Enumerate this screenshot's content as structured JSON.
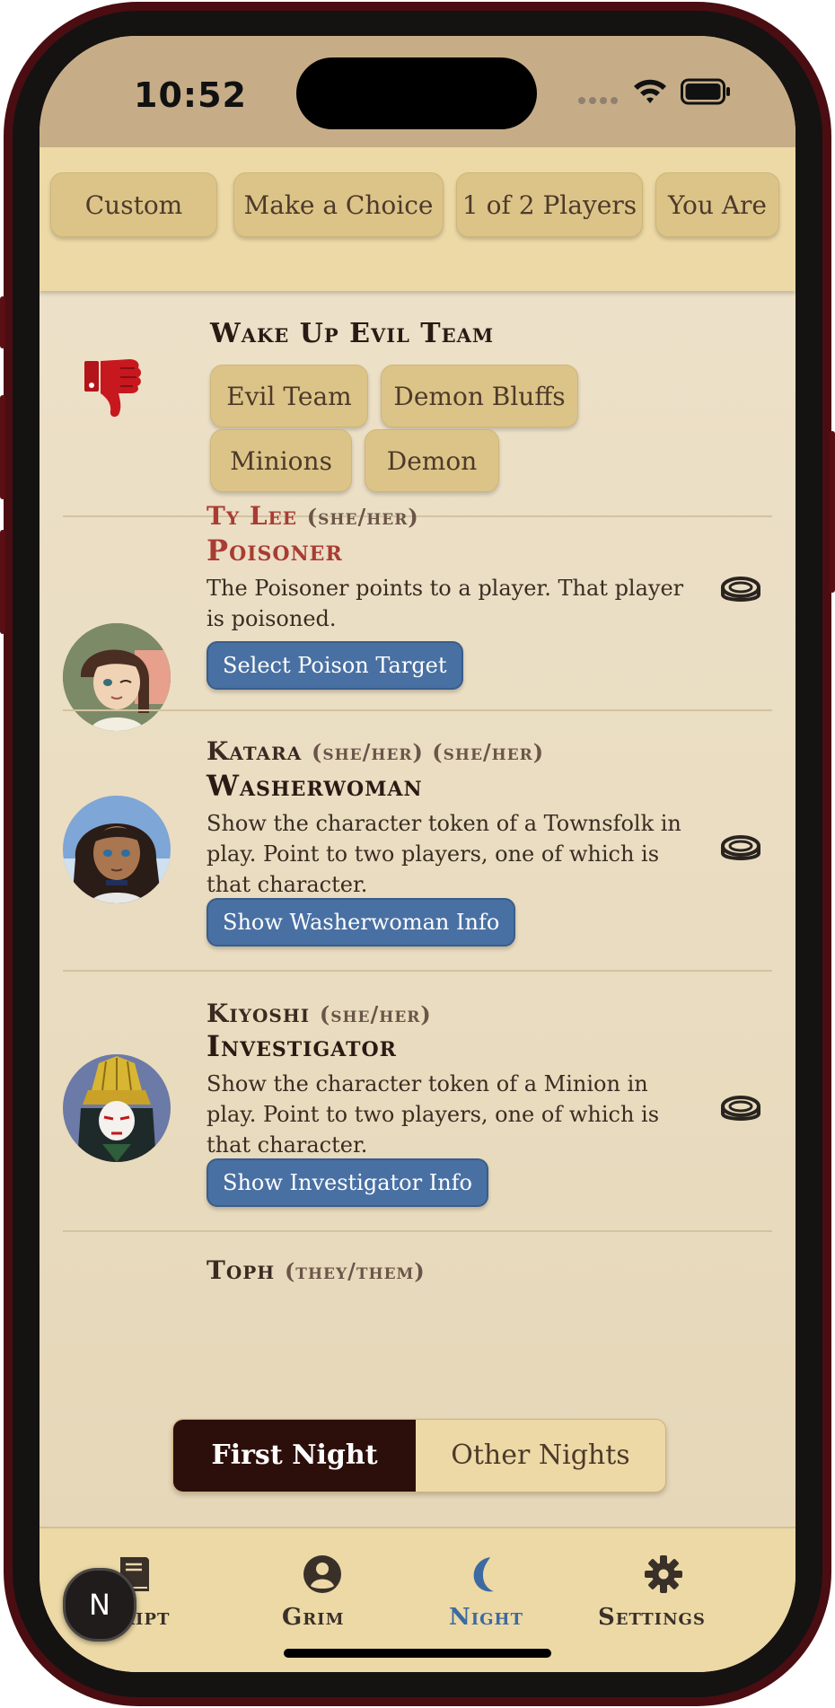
{
  "status_bar": {
    "time": "10:52"
  },
  "top_chips": [
    "Custom",
    "Make a Choice",
    "1 of 2 Players",
    "You Are"
  ],
  "evil_section": {
    "title": "Wake Up Evil Team",
    "buttons": [
      "Evil Team",
      "Demon Bluffs",
      "Minions",
      "Demon"
    ]
  },
  "entries": [
    {
      "player": "Ty Lee",
      "pronouns": "(she/her)",
      "role": "Poisoner",
      "description": "The Poisoner points to a player. That player is poisoned.",
      "action": "Select Poison Target",
      "player_color": "#a93c33",
      "role_color": "#a93c33"
    },
    {
      "player": "Katara",
      "pronouns": "(she/her) (she/her)",
      "role": "Washerwoman",
      "description": "Show the character token of a Townsfolk in play. Point to two players, one of which is that character.",
      "action": "Show Washerwoman Info",
      "player_color": "#3a2a22",
      "role_color": "#2a1a14"
    },
    {
      "player": "Kiyoshi",
      "pronouns": "(she/her)",
      "role": "Investigator",
      "description": "Show the character token of a Minion in play. Point to two players, one of which is that character.",
      "action": "Show Investigator Info",
      "player_color": "#3a2a22",
      "role_color": "#2a1a14"
    },
    {
      "player": "Toph",
      "pronouns": "(they/them)"
    }
  ],
  "night_toggle": {
    "first": "First Night",
    "other": "Other Nights",
    "selected": "First Night"
  },
  "tabs": [
    {
      "label": "Script",
      "icon": "book-icon"
    },
    {
      "label": "Grim",
      "icon": "user-circle-icon"
    },
    {
      "label": "Night",
      "icon": "moon-icon"
    },
    {
      "label": "Settings",
      "icon": "gear-icon"
    }
  ],
  "active_tab": "Night",
  "colors": {
    "accent_blue": "#3d6aa0",
    "evil_red": "#c0181e",
    "parchment": "#ecd9a6",
    "dark_maroon": "#2c0e0a"
  },
  "badge": "N"
}
